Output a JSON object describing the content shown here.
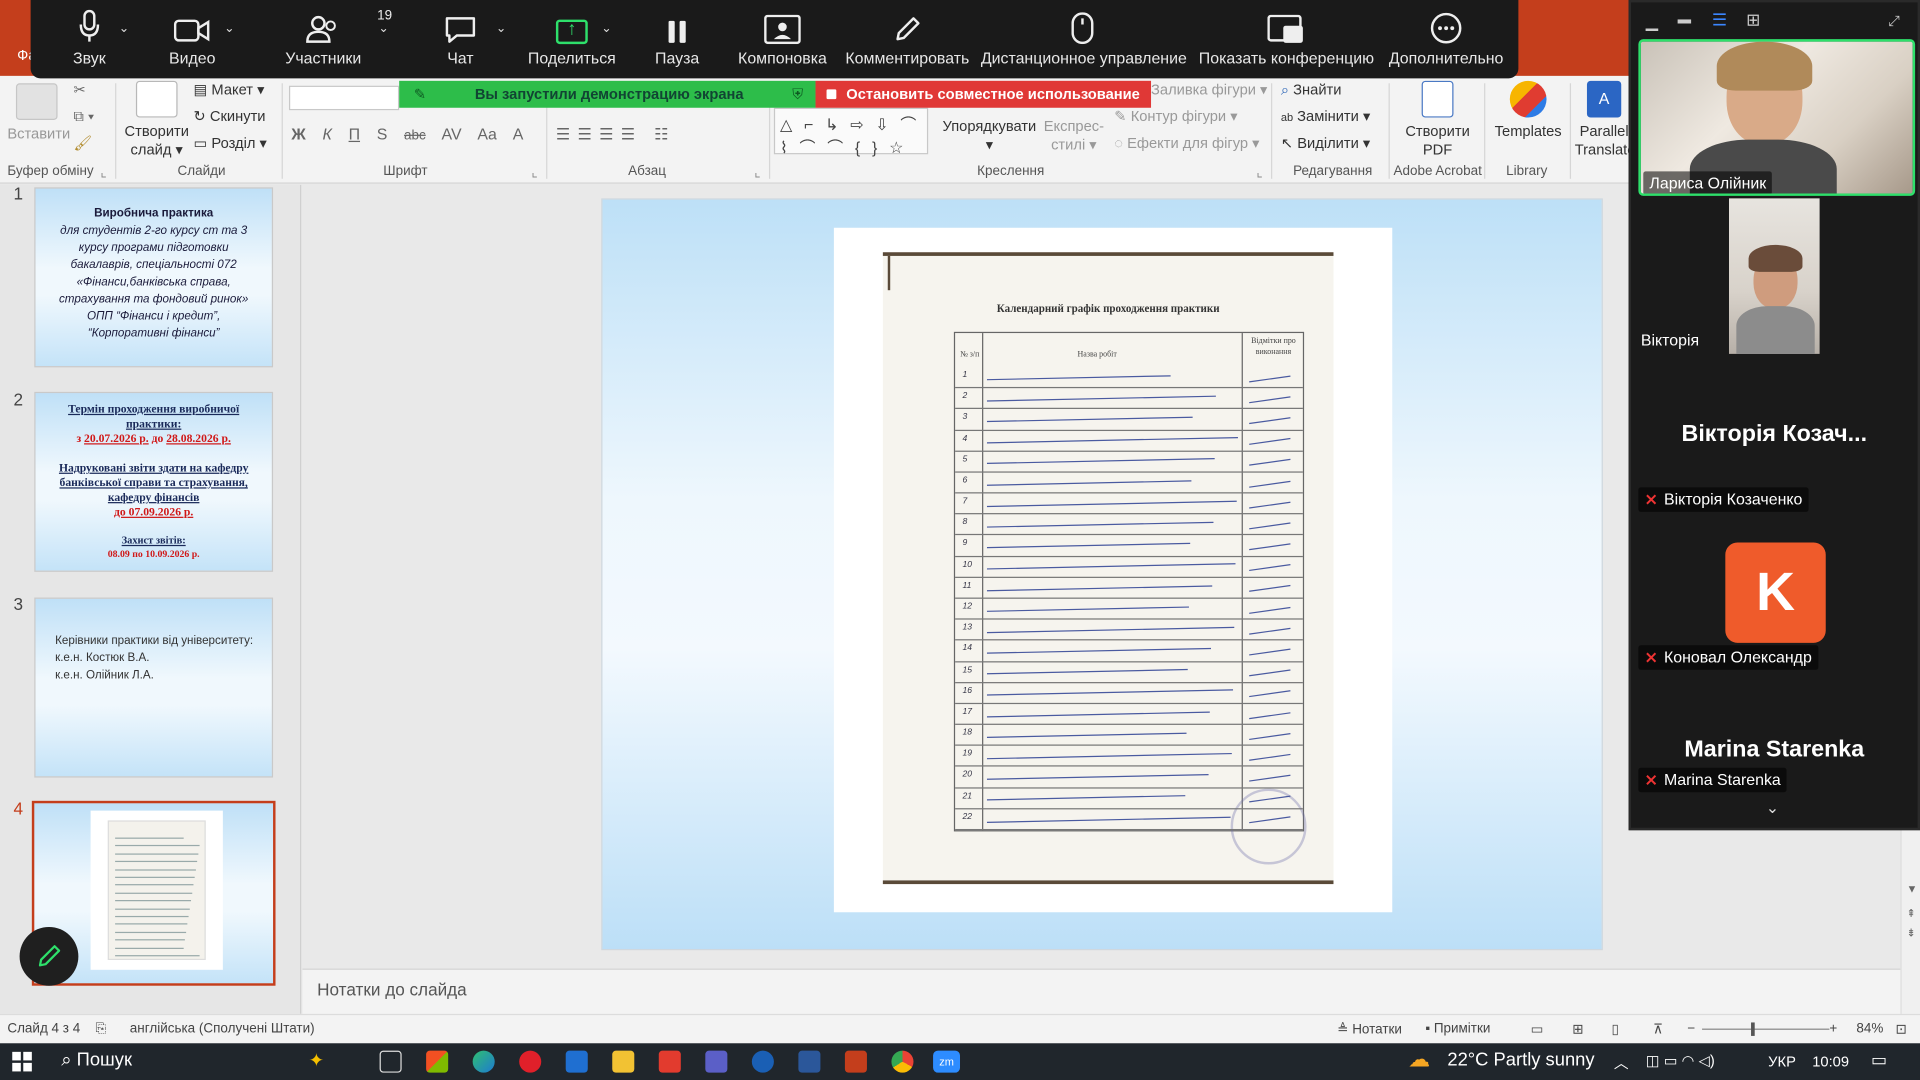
{
  "powerpoint": {
    "file_tab": "Фа",
    "ribbon": {
      "clipboard": {
        "paste": "Вставити",
        "group": "Буфер обміну"
      },
      "slides": {
        "new_slide_l1": "Створити",
        "new_slide_l2": "слайд",
        "layout": "Макет",
        "reset": "Скинути",
        "section": "Розділ",
        "group": "Слайди"
      },
      "font": {
        "group": "Шрифт",
        "bold": "Ж",
        "italic": "К",
        "underline": "П",
        "shadow": "S",
        "strike": "abc",
        "spacing": "AV",
        "case": "Aa",
        "color": "A"
      },
      "paragraph": {
        "group": "Абзац"
      },
      "drawing": {
        "arrange": "Упорядкувати",
        "quick_styles_l1": "Експрес-",
        "quick_styles_l2": "стилі",
        "fill": "Заливка фігури",
        "outline": "Контур фігури",
        "effects": "Ефекти для фігур",
        "group": "Креслення"
      },
      "editing": {
        "find": "Знайти",
        "replace": "Замінити",
        "select": "Виділити",
        "group": "Редагування"
      },
      "acrobat": {
        "create_pdf_l1": "Створити",
        "create_pdf_l2": "PDF",
        "group": "Adobe Acrobat"
      },
      "library": {
        "templates": "Templates",
        "group": "Library"
      },
      "translate": {
        "l1": "Parallel",
        "l2": "Translate"
      }
    },
    "slides": [
      {
        "number": "1",
        "lines": [
          "Виробнича практика",
          "для студентів 2-го курсу ст та 3",
          "курсу програми підготовки",
          "бакалаврів, спеціальності 072",
          "«Фінанси,банківська справа,",
          "страхування та фондовий ринок»",
          "ОПП “Фінанси і кредит”,",
          "“Корпоративні фінанси”"
        ]
      },
      {
        "number": "2",
        "title_l1": "Термін проходження виробничої",
        "title_l2": "практики:",
        "dates_prefix": "з ",
        "date_from": "20.07.2026 р.",
        "dates_mid": " до ",
        "date_to": "28.08.2026 р.",
        "reports_l1": "Надруковані звіти здати на кафедру",
        "reports_l2": "банківської справи та страхування,",
        "reports_l3": "кафедру фінансів",
        "reports_due": "до 07.09.2026 р.",
        "defense_title": "Захист звітів:",
        "defense_dates": "08.09 по 10.09.2026 р."
      },
      {
        "number": "3",
        "lines": [
          "Керівники практики від університету:",
          "к.е.н. Костюк В.А.",
          "к.е.н. Олійник Л.А."
        ]
      },
      {
        "number": "4"
      }
    ],
    "document": {
      "heading": "Календарний графік проходження практики",
      "col_no": "№ з/п",
      "col_work": "Назва робіт",
      "col_marks": "Відмітки про виконання",
      "row_numbers": [
        "1",
        "2",
        "3",
        "4",
        "5",
        "6",
        "7",
        "8",
        "9",
        "10",
        "11",
        "12",
        "13",
        "14",
        "15",
        "16",
        "17",
        "18",
        "19",
        "20",
        "21",
        "22"
      ]
    },
    "notes_placeholder": "Нотатки до слайда",
    "status": {
      "slide_counter": "Слайд 4 з 4",
      "language": "англійська (Сполучені Штати)",
      "notes": "Нотатки",
      "comments": "Примітки",
      "zoom": "84%"
    }
  },
  "zoom": {
    "toolbar": {
      "audio": "Звук",
      "video": "Видео",
      "participants": "Участники",
      "participants_count": "19",
      "chat": "Чат",
      "share": "Поделиться",
      "pause": "Пауза",
      "layout": "Компоновка",
      "annotate": "Комментировать",
      "remote": "Дистанционное управление",
      "show_conference": "Показать конференцию",
      "more": "Дополнительно"
    },
    "notice_sharing": "Вы запустили демонстрацию экрана",
    "stop_sharing": "Остановить совместное использование",
    "participants_panel": [
      {
        "name": "Лариса Олійник"
      },
      {
        "name": "Вікторія"
      },
      {
        "display": "Вікторія Козач...",
        "name": "Вікторія Козаченко"
      },
      {
        "initial": "K",
        "name": "Коновал Олександр"
      },
      {
        "display": "Marina Starenka",
        "name": "Marina Starenka"
      }
    ],
    "accent_green": "#2ee06b",
    "stop_red": "#e03836"
  },
  "taskbar": {
    "search": "Пошук",
    "weather": "22°C  Partly sunny",
    "lang": "УКР",
    "time": "10:09"
  }
}
